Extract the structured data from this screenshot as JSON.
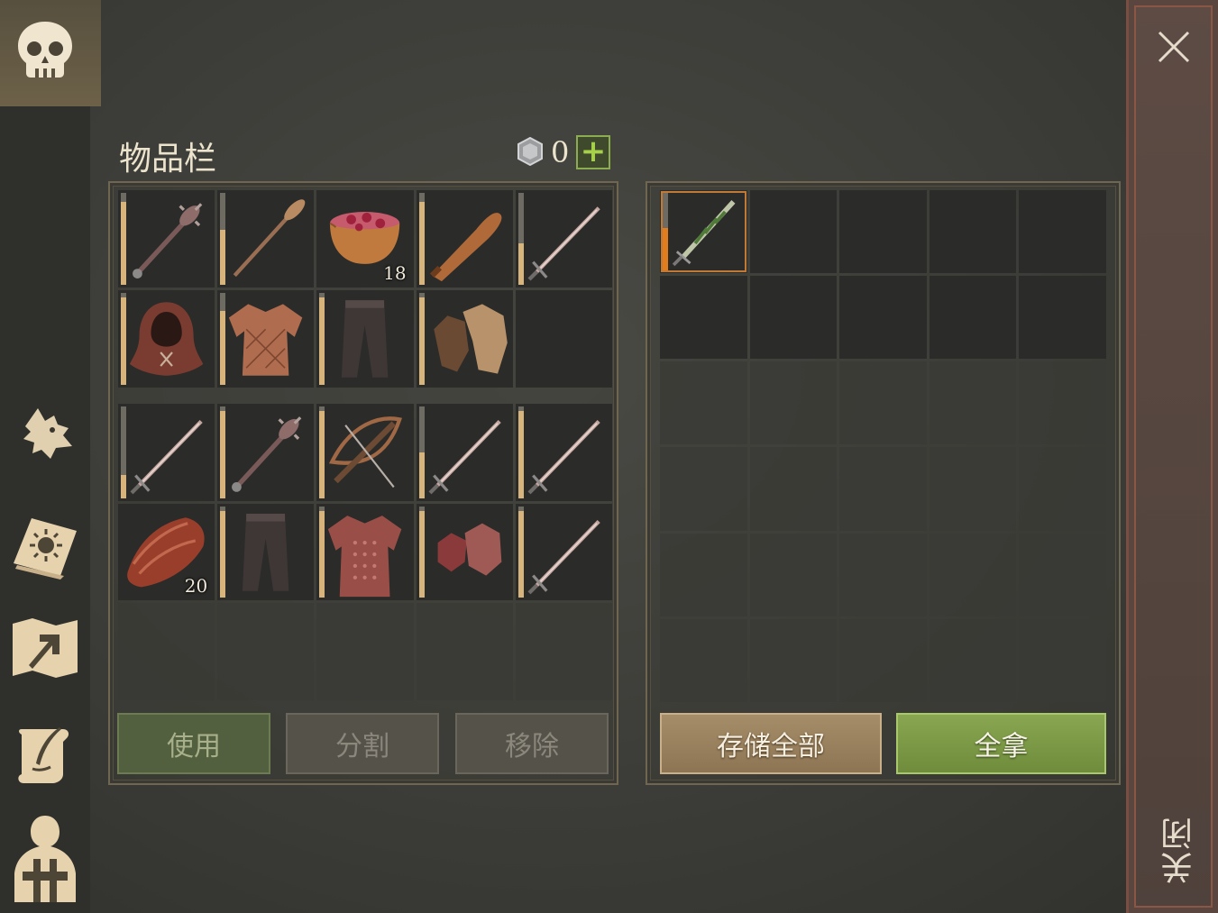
{
  "sidebar": {
    "icons": [
      "skull-icon",
      "wolf-icon",
      "sun-book-icon",
      "map-arrow-icon",
      "quill-scroll-icon",
      "character-icon"
    ]
  },
  "inventory": {
    "title": "物品栏",
    "currency_count": "0",
    "add_label": "+",
    "main_slots": [
      {
        "icon": "mace-icon",
        "durability": 0.9,
        "qty": ""
      },
      {
        "icon": "oar-icon",
        "durability": 0.6,
        "qty": ""
      },
      {
        "icon": "berry-bowl-icon",
        "durability": null,
        "qty": "18"
      },
      {
        "icon": "club-icon",
        "durability": 0.9,
        "qty": ""
      },
      {
        "icon": "sword-icon",
        "durability": 0.45,
        "qty": ""
      },
      {
        "icon": "hood-icon",
        "durability": 0.95,
        "qty": ""
      },
      {
        "icon": "padded-jacket-icon",
        "durability": 0.8,
        "qty": ""
      },
      {
        "icon": "pants-icon",
        "durability": 0.95,
        "qty": ""
      },
      {
        "icon": "gloves-icon",
        "durability": 0.95,
        "qty": ""
      },
      {
        "icon": "",
        "durability": null,
        "qty": ""
      }
    ],
    "backpack_slots": [
      {
        "icon": "sword-icon",
        "durability": 0.25,
        "qty": ""
      },
      {
        "icon": "mace-icon",
        "durability": 0.95,
        "qty": ""
      },
      {
        "icon": "crossbow-icon",
        "durability": 0.95,
        "qty": ""
      },
      {
        "icon": "sword-icon",
        "durability": 0.5,
        "qty": ""
      },
      {
        "icon": "sword-icon",
        "durability": 0.95,
        "qty": ""
      },
      {
        "icon": "leather-icon",
        "durability": null,
        "qty": "20"
      },
      {
        "icon": "pants-icon",
        "durability": 0.95,
        "qty": ""
      },
      {
        "icon": "chainmail-icon",
        "durability": 0.95,
        "qty": ""
      },
      {
        "icon": "chain-gloves-icon",
        "durability": 0.95,
        "qty": ""
      },
      {
        "icon": "sword-icon",
        "durability": 0.95,
        "qty": ""
      }
    ],
    "use_label": "使用",
    "split_label": "分割",
    "remove_label": "移除"
  },
  "container": {
    "slots": [
      {
        "icon": "green-dagger-icon",
        "durability": 0.55,
        "selected": true
      }
    ],
    "store_all_label": "存储全部",
    "take_all_label": "全拿"
  },
  "close": {
    "label": "关闭"
  },
  "colors": {
    "background": "#3c3c38",
    "accent_gold": "#d8b47d",
    "accent_green": "#89a651",
    "selected_orange": "#e27d1e",
    "close_strip": "#5d4b44"
  }
}
